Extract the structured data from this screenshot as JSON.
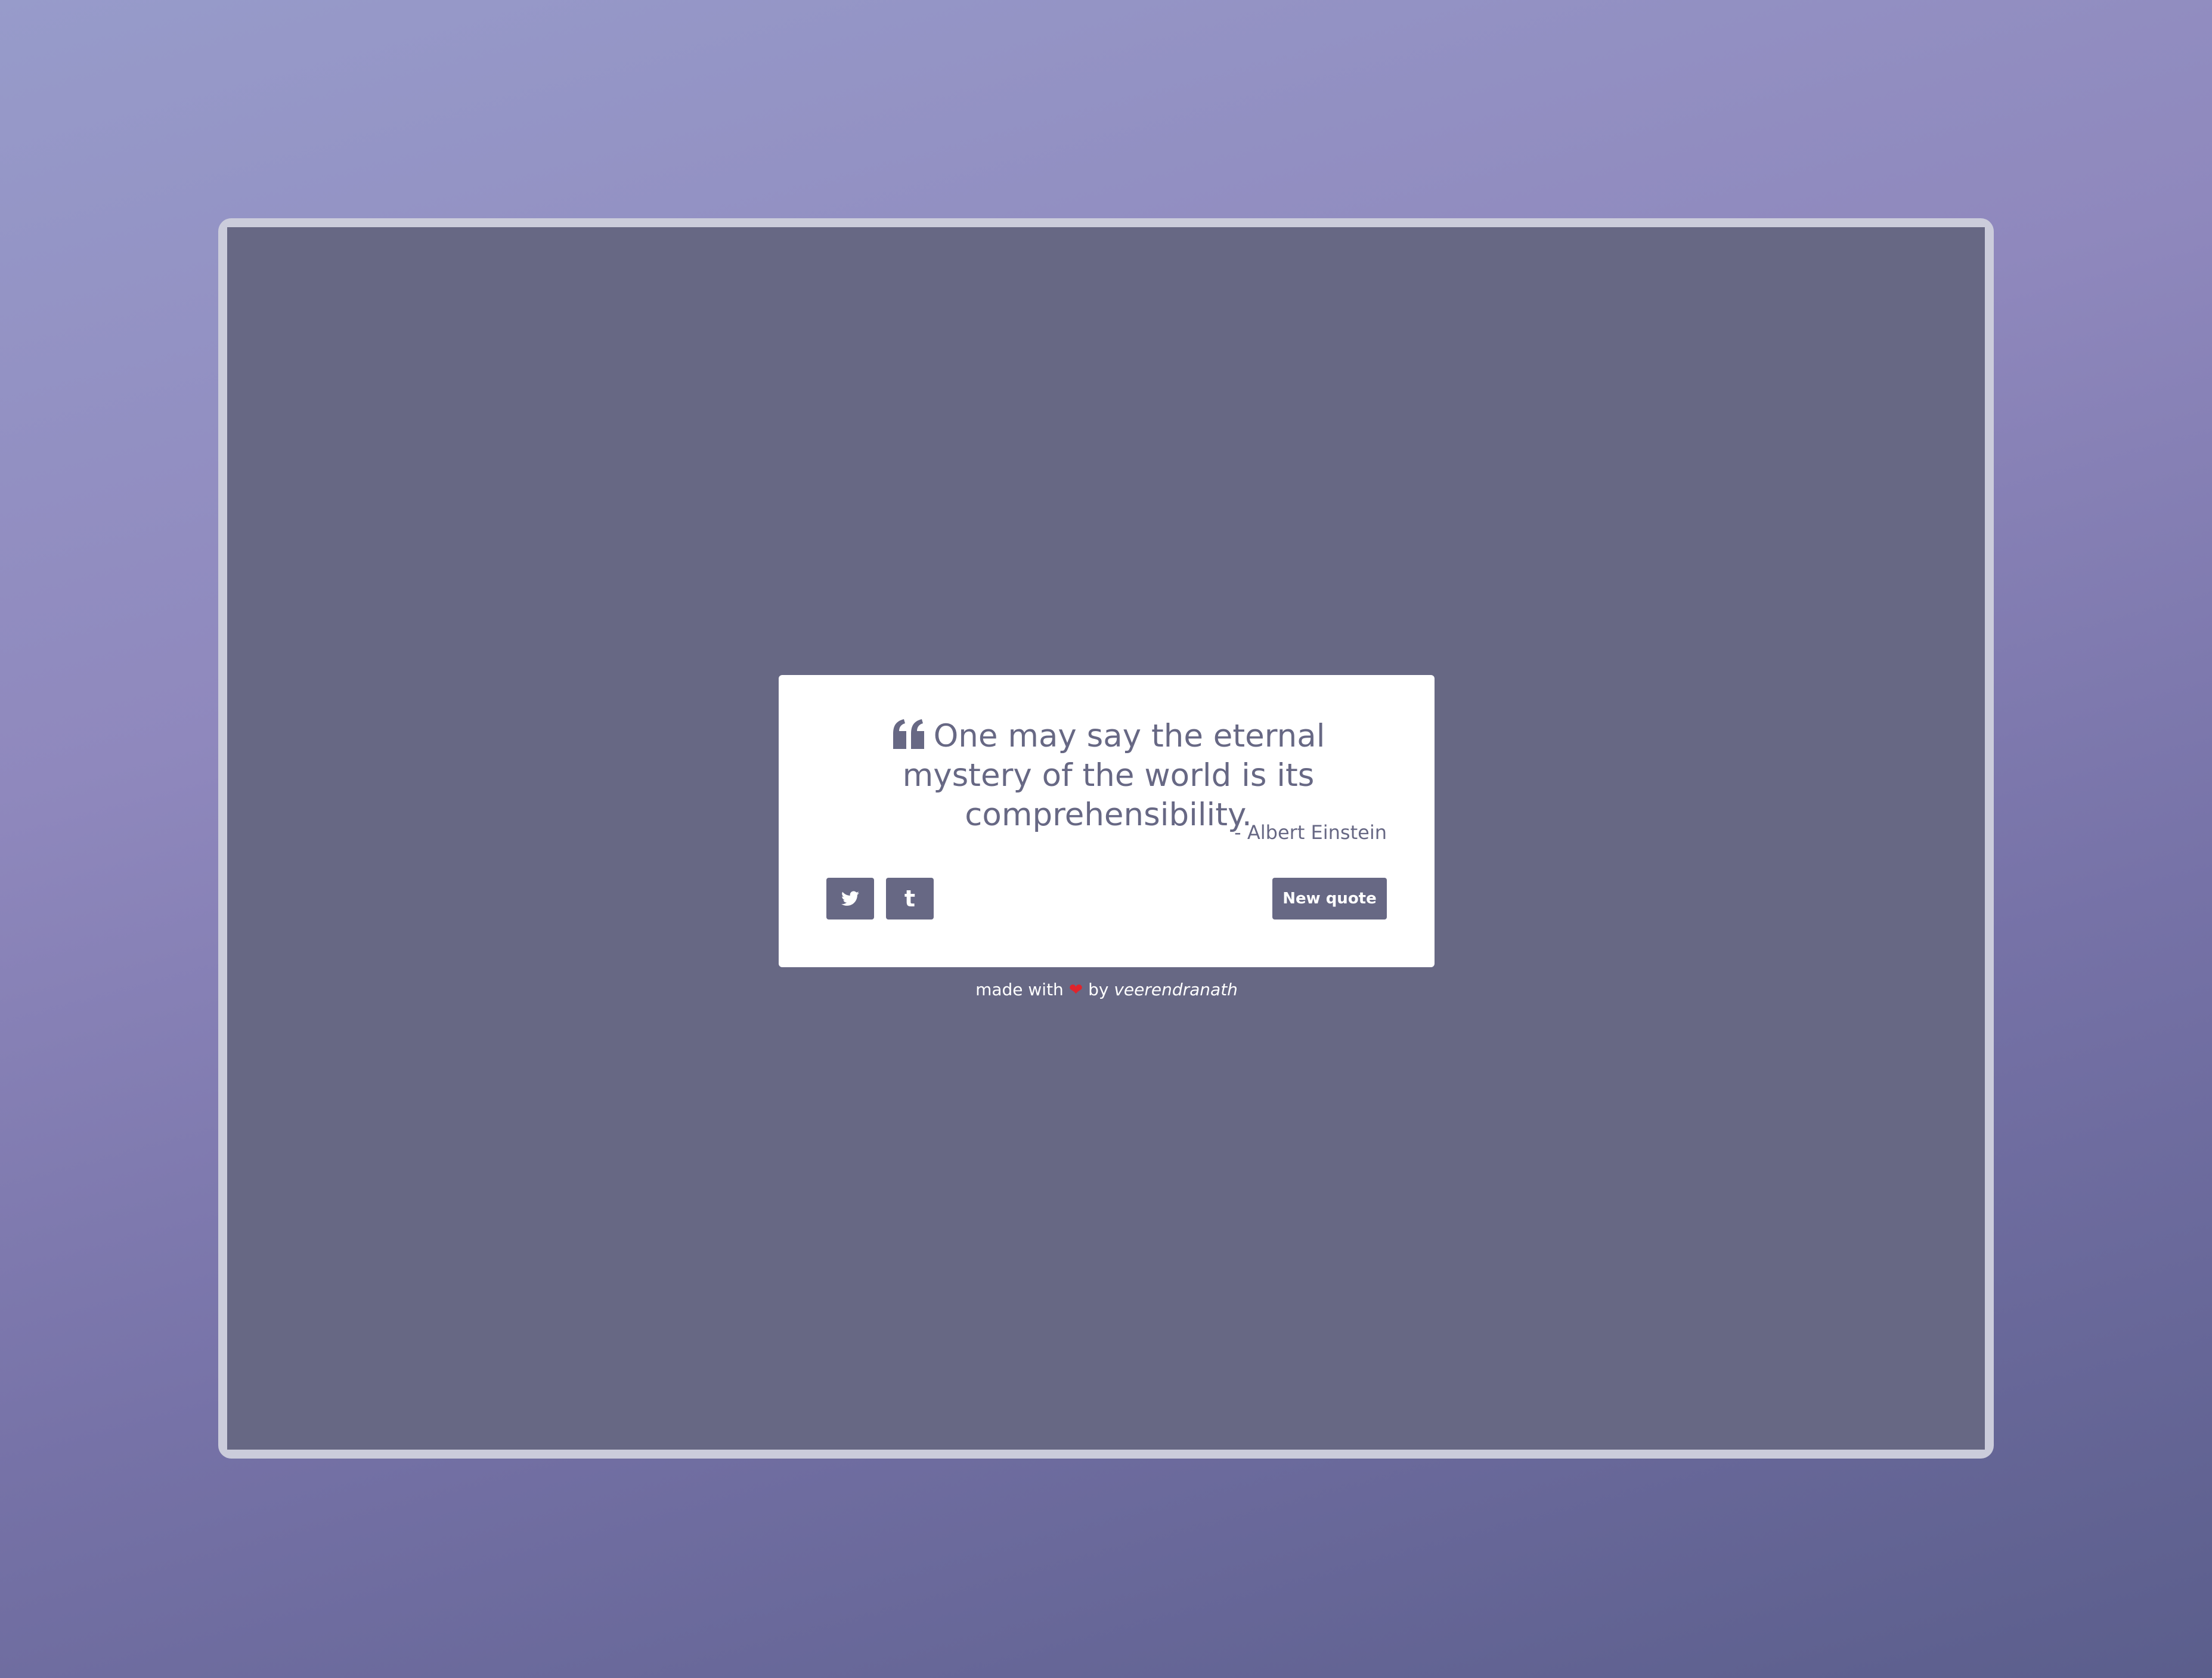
{
  "colors": {
    "accent": "#676884",
    "card_background": "#ffffff",
    "heart": "#e0242c"
  },
  "quote": {
    "icon": "quote-left-icon",
    "text": "One may say the eternal mystery of the world is its comprehensibility.",
    "author": "- Albert Einstein"
  },
  "actions": {
    "twitter_icon": "twitter-icon",
    "tumblr_icon": "tumblr-icon",
    "tumblr_glyph": "t",
    "new_quote_label": "New quote"
  },
  "footer": {
    "prefix": "made with",
    "heart": "❤",
    "by": "by",
    "author": "veerendranath"
  }
}
